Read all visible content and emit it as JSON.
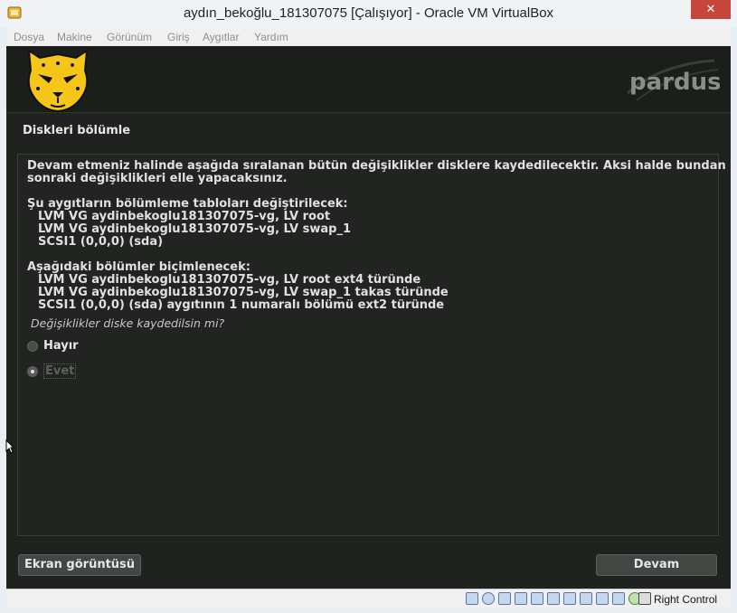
{
  "window": {
    "title": "aydın_bekoğlu_181307075 [Çalışıyor] - Oracle VM VirtualBox",
    "close_glyph": "✕"
  },
  "menubar": {
    "items": [
      "Dosya",
      "Makine",
      "Görünüm",
      "Giriş",
      "Aygıtlar",
      "Yardım"
    ]
  },
  "installer": {
    "brand": "pardus",
    "dialog_title": "Diskleri bölümle",
    "intro": "Devam etmeniz halinde aşağıda sıralanan bütün değişiklikler disklere kaydedilecektir. Aksi halde bundan\nsonraki değişiklikleri elle yapacaksınız.",
    "partition_tables_heading": "Şu aygıtların bölümleme tabloları değiştirilecek:",
    "partition_tables": [
      "LVM VG aydinbekoglu181307075-vg, LV root",
      "LVM VG aydinbekoglu181307075-vg, LV swap_1",
      "SCSI1 (0,0,0) (sda)"
    ],
    "format_heading": "Aşağıdaki bölümler biçimlenecek:",
    "format_items": [
      "LVM VG aydinbekoglu181307075-vg, LV root ext4 türünde",
      "LVM VG aydinbekoglu181307075-vg, LV swap_1 takas türünde",
      "SCSI1 (0,0,0) (sda) aygıtının 1 numaralı bölümü ext2 türünde"
    ],
    "question": "Değişiklikler diske kaydedilsin mi?",
    "options": [
      {
        "label": "Hayır",
        "selected": false
      },
      {
        "label": "Evet",
        "selected": true
      }
    ],
    "screenshot_button": "Ekran görüntüsü",
    "continue_button": "Devam"
  },
  "statusbar": {
    "host_key": "Right Control",
    "icons": [
      "hard-disk-icon",
      "optical-drive-icon",
      "audio-icon",
      "network-icon",
      "usb-icon",
      "shared-folders-icon",
      "display-icon",
      "video-capture-icon",
      "recording-icon",
      "cpu-icon",
      "virtualization-icon",
      "mouse-integration-icon",
      "keyboard-icon"
    ]
  },
  "colors": {
    "screen_bg": "#1f221f",
    "accent_yellow": "#f5c518",
    "close_red": "#c7463c"
  }
}
